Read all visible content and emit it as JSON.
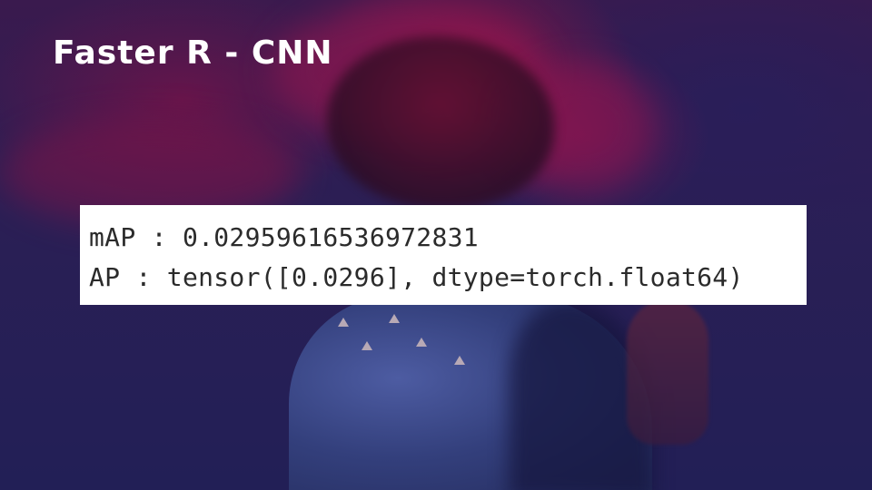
{
  "slide": {
    "title": "Faster R - CNN"
  },
  "output": {
    "lines": [
      "mAP : 0.02959616536972831",
      "AP : tensor([0.0296], dtype=torch.float64)"
    ]
  },
  "colors": {
    "background": "#221f56",
    "smoke_accent": "#96144a",
    "title_text": "#ffffff",
    "output_background": "#ffffff",
    "output_text": "#2b2b2b"
  }
}
